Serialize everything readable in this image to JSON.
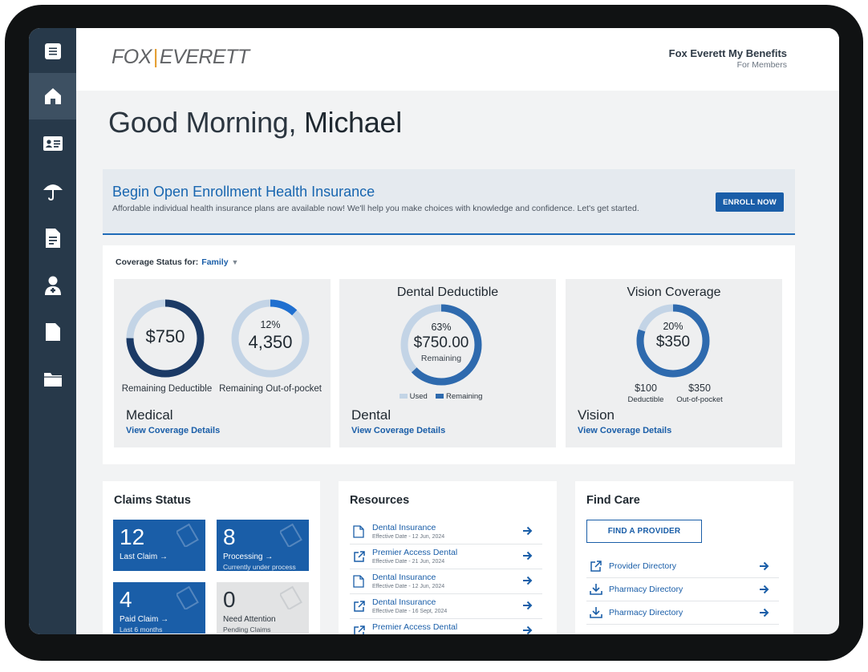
{
  "header": {
    "logo_left": "FOX",
    "logo_right": "EVERETT",
    "title": "Fox Everett My Benefits",
    "subtitle": "For Members"
  },
  "sidebar": {
    "items": [
      {
        "icon": "menu-icon"
      },
      {
        "icon": "home-icon",
        "active": true
      },
      {
        "icon": "id-card-icon"
      },
      {
        "icon": "umbrella-icon"
      },
      {
        "icon": "document-icon"
      },
      {
        "icon": "doctor-icon"
      },
      {
        "icon": "file-icon"
      },
      {
        "icon": "folder-icon"
      }
    ]
  },
  "greeting": {
    "prefix": "Good Morning,",
    "name": "Michael"
  },
  "banner": {
    "title": "Begin Open Enrollment Health Insurance",
    "description": "Affordable individual health insurance plans are available now! We'll help you make choices with knowledge and confidence.  Let's get started.",
    "button": "ENROLL NOW"
  },
  "coverage": {
    "label": "Coverage Status for:",
    "selected": "Family",
    "medical": {
      "name": "Medical",
      "link": "View Coverage Details",
      "deductible_value": "$750",
      "deductible_label": "Remaining Deductible",
      "deductible_fraction": 0.75,
      "oop_percent": "12%",
      "oop_value": "4,350",
      "oop_label": "Remaining Out-of-pocket",
      "oop_fraction": 0.12
    },
    "dental": {
      "title": "Dental Deductible",
      "name": "Dental",
      "link": "View Coverage Details",
      "percent": "63%",
      "value": "$750.00",
      "sub": "Remaining",
      "fraction": 0.63,
      "legend_used": "Used",
      "legend_remaining": "Remaining"
    },
    "vision": {
      "title": "Vision Coverage",
      "name": "Vision",
      "link": "View Coverage Details",
      "percent": "20%",
      "value": "$350",
      "fraction": 0.8,
      "deductible_value": "$100",
      "deductible_label": "Deductible",
      "oop_value": "$350",
      "oop_label": "Out-of-pocket"
    }
  },
  "claims": {
    "title": "Claims Status",
    "tiles": [
      {
        "number": "12",
        "label": "Last Claim →",
        "sub": ""
      },
      {
        "number": "8",
        "label": "Processing →",
        "sub": "Currently under process"
      },
      {
        "number": "4",
        "label": "Paid Claim →",
        "sub": "Last 6 months"
      },
      {
        "number": "0",
        "label": "Need Attention",
        "sub": "Pending Claims"
      }
    ]
  },
  "resources": {
    "title": "Resources",
    "items": [
      {
        "name": "Dental Insurance",
        "date": "Effective Date - 12 Jun, 2024",
        "icon": "document-icon"
      },
      {
        "name": "Premier Access Dental",
        "date": "Effective Date - 21 Jun, 2024",
        "icon": "external-link-icon"
      },
      {
        "name": "Dental Insurance",
        "date": "Effective Date - 12 Jun, 2024",
        "icon": "document-icon"
      },
      {
        "name": "Dental Insurance",
        "date": "Effective Date - 16 Sept, 2024",
        "icon": "external-link-icon"
      },
      {
        "name": "Premier Access Dental",
        "date": "",
        "icon": "external-link-icon"
      }
    ]
  },
  "find_care": {
    "title": "Find Care",
    "button": "FIND A PROVIDER",
    "items": [
      {
        "name": "Provider Directory",
        "icon": "external-link-icon"
      },
      {
        "name": "Pharmacy Directory",
        "icon": "download-icon"
      },
      {
        "name": "Pharmacy Directory",
        "icon": "download-icon"
      }
    ]
  },
  "colors": {
    "sidebar": "#27394a",
    "primary_blue": "#1a5ea8",
    "ring_dark": "#1b3a66",
    "ring_mid": "#2e6aae",
    "ring_bright": "#1f6fd0",
    "ring_light": "#c3d4e6"
  }
}
